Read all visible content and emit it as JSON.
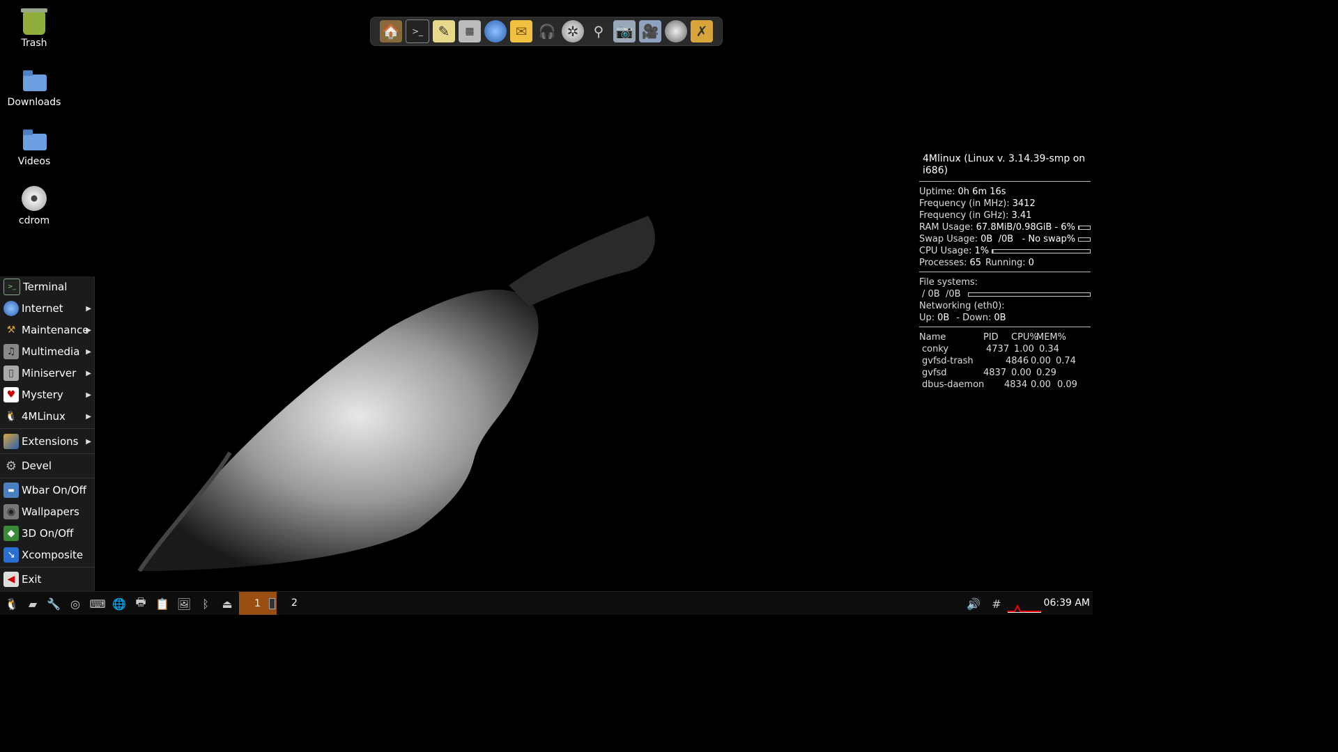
{
  "desktop": {
    "icons": [
      {
        "label": "Trash",
        "icon": "trash-icon"
      },
      {
        "label": "Downloads",
        "icon": "folder-icon"
      },
      {
        "label": "Videos",
        "icon": "folder-icon"
      },
      {
        "label": "cdrom",
        "icon": "disc-icon"
      }
    ]
  },
  "dock": {
    "icons": [
      "home-folder-icon",
      "terminal-icon",
      "text-editor-icon",
      "calculator-icon",
      "globe-icon",
      "mail-icon",
      "headphones-icon",
      "film-reel-icon",
      "search-icon",
      "camera-icon",
      "video-camera-icon",
      "webcam-icon",
      "wbar-settings-icon"
    ]
  },
  "conky": {
    "title": "4Mlinux (Linux v. 3.14.39-smp on i686)",
    "uptime_label": "Uptime:",
    "uptime": "0h 6m 16s",
    "freq_mhz_label": "Frequency (in MHz):",
    "freq_mhz": "3412",
    "freq_ghz_label": "Frequency (in GHz):",
    "freq_ghz": "3.41",
    "ram_label": "RAM Usage:",
    "ram": "67.8MiB/0.98GiB - 6%",
    "ram_pct": 6,
    "swap_label": "Swap Usage:",
    "swap": "0B  /0B   - No swap%",
    "swap_pct": 0,
    "cpu_label": "CPU Usage:",
    "cpu": "1%",
    "cpu_pct": 1,
    "processes_label": "Processes:",
    "processes": "65",
    "running_label": "Running:",
    "running": "0",
    "fs_label": "File systems:",
    "fs": "/ 0B  /0B",
    "fs_pct": 0,
    "net_label": "Networking (eth0):",
    "up_label": "Up:",
    "up": "0B",
    "down_label": "- Down:",
    "down": "0B",
    "proc_headers": [
      "Name",
      "PID",
      "CPU%",
      "MEM%"
    ],
    "procs": [
      [
        "conky",
        "4737",
        "1.00",
        "0.34"
      ],
      [
        "gvfsd-trash",
        "4846",
        "0.00",
        "0.74"
      ],
      [
        "gvfsd",
        "4837",
        "0.00",
        "0.29"
      ],
      [
        "dbus-daemon",
        "4834",
        "0.00",
        "0.09"
      ]
    ]
  },
  "menu": {
    "items": [
      {
        "label": "Terminal",
        "icon": "terminal-icon",
        "sub": false
      },
      {
        "label": "Internet",
        "icon": "globe-icon",
        "sub": true
      },
      {
        "label": "Maintenance",
        "icon": "hammer-icon",
        "sub": true
      },
      {
        "label": "Multimedia",
        "icon": "media-icon",
        "sub": true
      },
      {
        "label": "Miniserver",
        "icon": "server-icon",
        "sub": true
      },
      {
        "label": "Mystery",
        "icon": "cards-icon",
        "sub": true
      },
      {
        "label": "4MLinux",
        "icon": "tux-icon",
        "sub": true
      },
      {
        "label": "Extensions",
        "icon": "extensions-icon",
        "sub": true
      },
      {
        "label": "Devel",
        "icon": "gear-icon",
        "sub": false
      },
      {
        "label": "Wbar On/Off",
        "icon": "wbar-icon",
        "sub": false
      },
      {
        "label": "Wallpapers",
        "icon": "eye-icon",
        "sub": false
      },
      {
        "label": "3D On/Off",
        "icon": "cube-icon",
        "sub": false
      },
      {
        "label": "Xcomposite",
        "icon": "xcomposite-icon",
        "sub": false
      },
      {
        "label": "Exit",
        "icon": "exit-icon",
        "sub": false
      }
    ]
  },
  "taskbar": {
    "workspace_1": "1",
    "workspace_2": "2",
    "clock": "06:39 AM"
  }
}
